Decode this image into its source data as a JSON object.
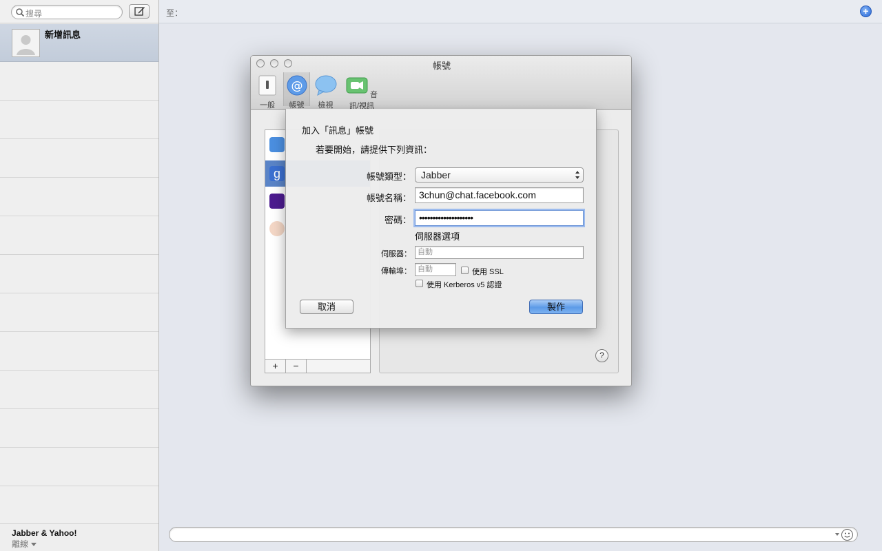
{
  "sidebar": {
    "search_placeholder": "搜尋",
    "active_conversation": "新增訊息",
    "account": {
      "name": "Jabber & Yahoo!",
      "status": "離線"
    }
  },
  "main": {
    "to_label": "至：",
    "add_recipient_symbol": "+"
  },
  "prefs": {
    "title": "帳號",
    "toolbar": [
      {
        "label": "一般",
        "icon": "light-switch-icon"
      },
      {
        "label": "帳號",
        "icon": "at-sign-icon"
      },
      {
        "label": "檢視",
        "icon": "speech-bubble-icon"
      },
      {
        "label": "音訊/視訊",
        "icon": "video-camera-icon"
      }
    ],
    "list_add": "+",
    "list_remove": "−",
    "help": "?"
  },
  "sheet": {
    "title": "加入「訊息」帳號",
    "subtitle": "若要開始，請提供下列資訊：",
    "account_type_label": "帳號類型：",
    "account_type_value": "Jabber",
    "account_name_label": "帳號名稱：",
    "account_name_value": "3chun@chat.facebook.com",
    "password_label": "密碼：",
    "password_value": "••••••••••••••••••••",
    "server_options_label": "伺服器選項",
    "server_label": "伺服器：",
    "server_placeholder": "自動",
    "port_label": "傳輸埠：",
    "port_placeholder": "自動",
    "use_ssl_label": "使用 SSL",
    "use_kerberos_label": "使用 Kerberos v5 認證",
    "cancel_label": "取消",
    "create_label": "製作"
  },
  "colors": {
    "accent_blue": "#5d9be8",
    "selection": "#c2ccda",
    "focus_ring": "#9cbbee"
  }
}
